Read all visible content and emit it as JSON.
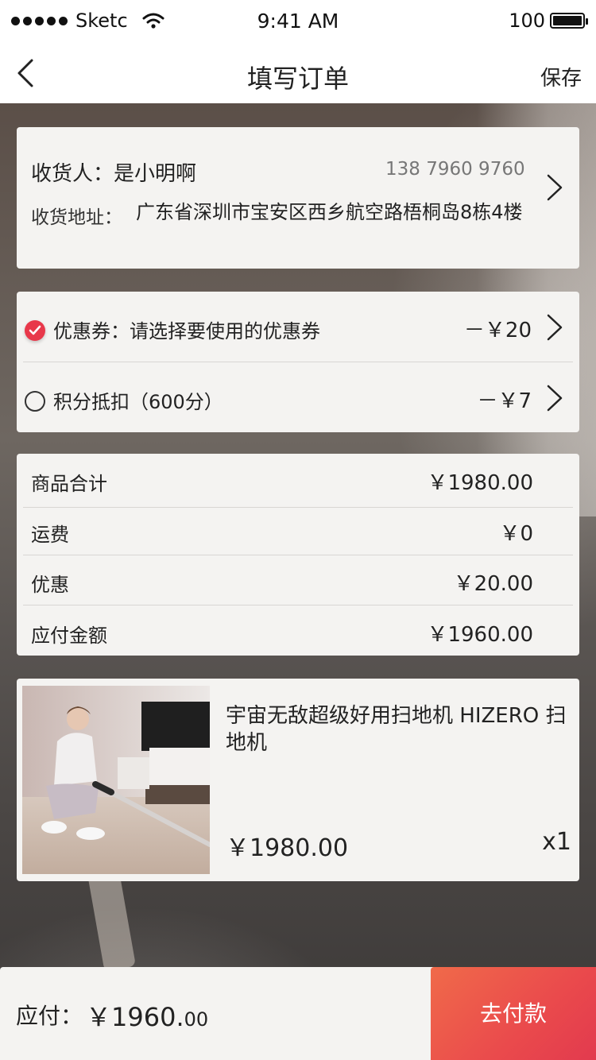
{
  "status_bar": {
    "carrier": "Sketc",
    "time": "9:41 AM",
    "battery": "100"
  },
  "nav": {
    "title": "填写订单",
    "save_label": "保存"
  },
  "address": {
    "name_label": "收货人：是小明啊",
    "phone": "138 7960 9760",
    "address_label": "收货地址：",
    "address_text": "广东省深圳市宝安区西乡航空路梧桐岛8栋4楼"
  },
  "discounts": [
    {
      "label": "优惠券：请选择要使用的优惠券",
      "value": "－￥20",
      "checked": true
    },
    {
      "label": "积分抵扣（600分）",
      "value": "－￥7",
      "checked": false
    }
  ],
  "summary": [
    {
      "label": "商品合计",
      "value": "￥1980.00"
    },
    {
      "label": "运费",
      "value": "￥0"
    },
    {
      "label": "优惠",
      "value": "￥20.00"
    },
    {
      "label": "应付金额",
      "value": "￥1960.00"
    }
  ],
  "product": {
    "title": "宇宙无敌超级好用扫地机 HIZERO 扫地机",
    "price": "￥1980.00",
    "quantity": "x1"
  },
  "footer": {
    "due_label": "应付：",
    "due_main": "￥1960.",
    "due_decimal": "00",
    "pay_label": "去付款"
  },
  "colors": {
    "accent_red": "#e8384a",
    "pay_gradient_start": "#f06a4a",
    "pay_gradient_end": "#e23a4e"
  }
}
